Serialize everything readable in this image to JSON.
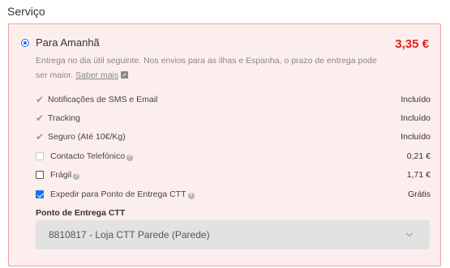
{
  "section": {
    "title": "Serviço"
  },
  "option": {
    "title": "Para Amanhã",
    "price": "3,35 €",
    "description": "Entrega no dia útil seguinte. Nos envios para as ilhas e Espanha, o prazo de entrega pode ser maior.",
    "more_link": "Saber mais",
    "selected": true
  },
  "features": [
    {
      "label": "Notificações de SMS e Email",
      "value": "Incluído"
    },
    {
      "label": "Tracking",
      "value": "Incluído"
    },
    {
      "label": "Seguro (Até 10€/Kg)",
      "value": "Incluído"
    }
  ],
  "extras": [
    {
      "label": "Contacto Telefónico",
      "value": "0,21 €",
      "checked": false,
      "disabled": true
    },
    {
      "label": "Frágil",
      "value": "1,71 €",
      "checked": false,
      "disabled": false
    },
    {
      "label": "Expedir para Ponto de Entrega CTT",
      "value": "Grátis",
      "checked": true,
      "disabled": false
    }
  ],
  "pickup": {
    "label": "Ponto de Entrega CTT",
    "selected_value": "8810817 - Loja CTT Parede (Parede)"
  },
  "colors": {
    "accent": "#e2231a",
    "card_bg": "#fdeeee",
    "card_border": "#f0a0a5",
    "radio": "#1a73e8"
  }
}
